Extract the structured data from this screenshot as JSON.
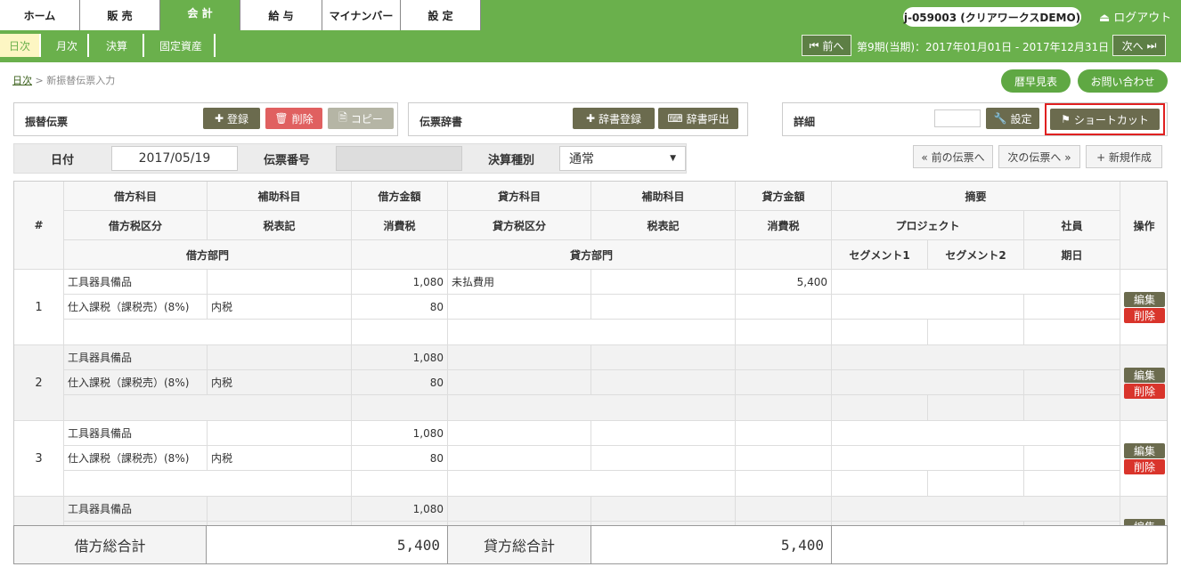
{
  "nav": {
    "tabs": [
      "ホーム",
      "販 売",
      "会 計",
      "給 与",
      "マイナンバー",
      "設 定"
    ],
    "account": "j-059003 (クリアワークスDEMO)",
    "logout": "ログアウト"
  },
  "subnav": {
    "tabs": [
      "日次",
      "月次",
      "決算",
      "固定資産"
    ],
    "prev": "前へ",
    "next": "次へ",
    "period": "第9期(当期)：2017年01月01日 - 2017年12月31日"
  },
  "breadcrumb": {
    "link": "日次",
    "current": "新振替伝票入力"
  },
  "header_buttons": {
    "calendar": "暦早見表",
    "contact": "お問い合わせ"
  },
  "voucher": {
    "title": "振替伝票",
    "register": "登録",
    "delete": "削除",
    "copy": "コピー"
  },
  "dictionary": {
    "title": "伝票辞書",
    "register": "辞書登録",
    "call": "辞書呼出"
  },
  "detail": {
    "title": "詳細",
    "settings": "設定",
    "shortcut": "ショートカット"
  },
  "form": {
    "date_label": "日付",
    "date_value": "2017/05/19",
    "number_label": "伝票番号",
    "number_value": "",
    "type_label": "決算種別",
    "type_value": "通常",
    "prev_voucher": "« 前の伝票へ",
    "next_voucher": "次の伝票へ »",
    "new": "+ 新規作成"
  },
  "table": {
    "h": {
      "num": "#",
      "dr_account": "借方科目",
      "dr_sub": "補助科目",
      "dr_amount": "借方金額",
      "cr_account": "貸方科目",
      "cr_sub": "補助科目",
      "cr_amount": "貸方金額",
      "memo": "摘要",
      "dr_tax": "借方税区分",
      "dr_taxmark": "税表記",
      "dr_ctax": "消費税",
      "cr_tax": "貸方税区分",
      "cr_taxmark": "税表記",
      "cr_ctax": "消費税",
      "project": "プロジェクト",
      "employee": "社員",
      "action": "操作",
      "dr_dept": "借方部門",
      "cr_dept": "貸方部門",
      "seg1": "セグメント1",
      "seg2": "セグメント2",
      "due": "期日"
    },
    "rows": [
      {
        "num": "1",
        "dr_account": "工具器具備品",
        "dr_amount": "1,080",
        "cr_account": "未払費用",
        "cr_amount": "5,400",
        "dr_tax": "仕入課税（課税売）(8%)",
        "dr_taxmark": "内税",
        "dr_ctax": "80"
      },
      {
        "num": "2",
        "dr_account": "工具器具備品",
        "dr_amount": "1,080",
        "cr_account": "",
        "cr_amount": "",
        "dr_tax": "仕入課税（課税売）(8%)",
        "dr_taxmark": "内税",
        "dr_ctax": "80"
      },
      {
        "num": "3",
        "dr_account": "工具器具備品",
        "dr_amount": "1,080",
        "cr_account": "",
        "cr_amount": "",
        "dr_tax": "仕入課税（課税売）(8%)",
        "dr_taxmark": "内税",
        "dr_ctax": "80"
      },
      {
        "num": "",
        "dr_account": "工具器具備品",
        "dr_amount": "1,080"
      }
    ],
    "edit": "編集",
    "delete": "削除"
  },
  "totals": {
    "dr_label": "借方総合計",
    "dr_value": "5,400",
    "cr_label": "貸方総合計",
    "cr_value": "5,400"
  }
}
